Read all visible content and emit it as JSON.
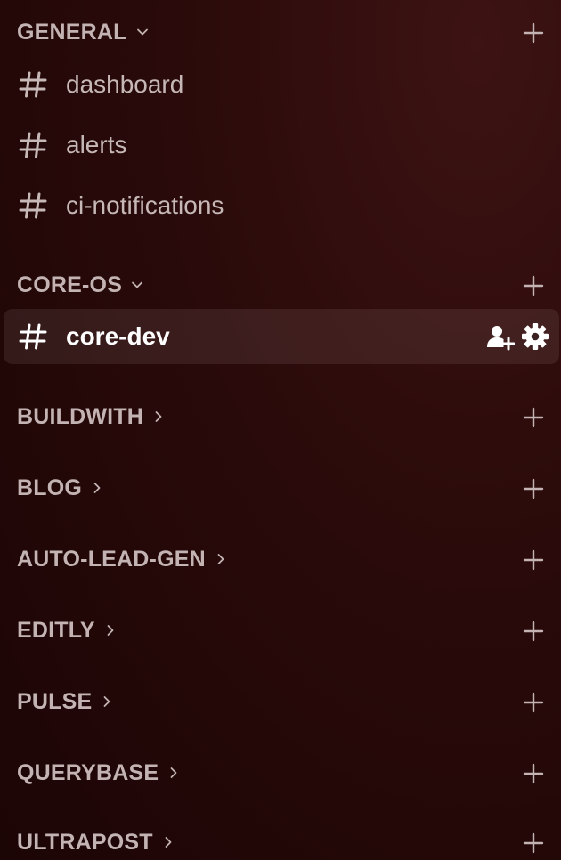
{
  "sidebar": {
    "categories": [
      {
        "label": "GENERAL",
        "expanded": true,
        "channels": [
          {
            "label": "dashboard",
            "active": false
          },
          {
            "label": "alerts",
            "active": false
          },
          {
            "label": "ci-notifications",
            "active": false
          }
        ]
      },
      {
        "label": "CORE-OS",
        "expanded": true,
        "channels": [
          {
            "label": "core-dev",
            "active": true
          }
        ]
      },
      {
        "label": "BUILDWITH",
        "expanded": false
      },
      {
        "label": "BLOG",
        "expanded": false
      },
      {
        "label": "AUTO-LEAD-GEN",
        "expanded": false
      },
      {
        "label": "EDITLY",
        "expanded": false
      },
      {
        "label": "PULSE",
        "expanded": false
      },
      {
        "label": "QUERYBASE",
        "expanded": false
      },
      {
        "label": "ULTRAPOST",
        "expanded": false
      }
    ],
    "icons": {
      "channel": "hash-icon",
      "add": "plus-icon",
      "expanded": "chevron-down-icon",
      "collapsed": "chevron-right-icon",
      "invite": "add-member-icon",
      "settings": "gear-icon"
    }
  },
  "colors": {
    "background": "#2a0a0a",
    "category_text": "#c3b3b3",
    "channel_text": "#c7b8b8",
    "active_text": "#ffffff"
  }
}
